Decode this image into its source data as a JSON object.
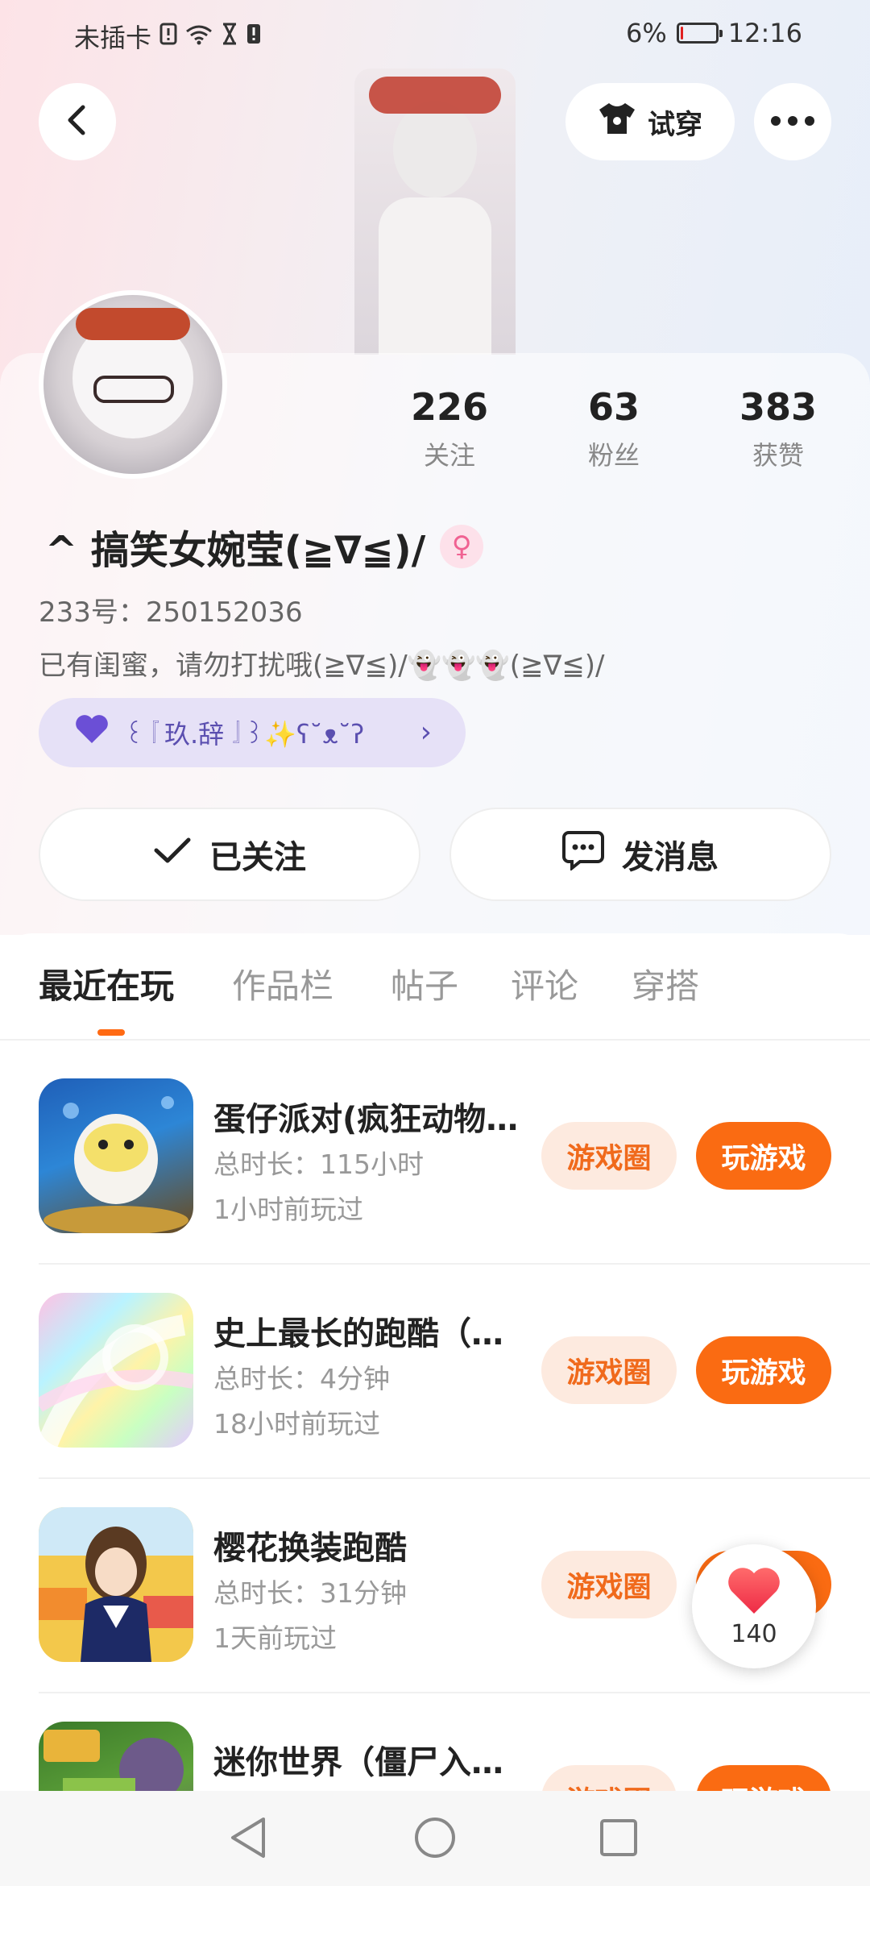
{
  "status_bar": {
    "carrier": "未插卡",
    "battery_percent": "6%",
    "battery_level": 0.06,
    "time": "12:16"
  },
  "header": {
    "back_icon": "chevron-left-icon",
    "try_on_label": "试穿",
    "try_on_icon": "tshirt-icon",
    "more_icon": "more-dots-icon"
  },
  "profile": {
    "stats": [
      {
        "value": "226",
        "label": "关注"
      },
      {
        "value": "63",
        "label": "粉丝"
      },
      {
        "value": "383",
        "label": "获赞"
      }
    ],
    "name": "^ 搞笑女婉莹(≧∇≦)/",
    "gender_symbol": "♀",
    "uid": "233号：250152036",
    "bio": "已有闺蜜，请勿打扰哦(≧∇≦)/👻👻👻(≧∇≦)/",
    "guild_name": "꒰『玖.辞』꒱✨ʕ˘ᴥ˘ʔ",
    "guild_icon": "purple-heart-icon"
  },
  "actions": {
    "follow_label": "已关注",
    "message_label": "发消息"
  },
  "tabs": [
    "最近在玩",
    "作品栏",
    "帖子",
    "评论",
    "穿搭"
  ],
  "games": [
    {
      "title": "蛋仔派对(疯狂动物…",
      "duration": "总时长：115小时",
      "last_played": "1小时前玩过",
      "circle_label": "游戏圈",
      "play_label": "玩游戏"
    },
    {
      "title": "史上最长的跑酷（…",
      "duration": "总时长：4分钟",
      "last_played": "18小时前玩过",
      "circle_label": "游戏圈",
      "play_label": "玩游戏"
    },
    {
      "title": "樱花换装跑酷",
      "duration": "总时长：31分钟",
      "last_played": "1天前玩过",
      "circle_label": "游戏圈",
      "play_label": "玩游戏"
    },
    {
      "title": "迷你世界（僵尸入…",
      "duration": "",
      "last_played": "",
      "circle_label": "游戏圈",
      "play_label": "玩游戏"
    }
  ],
  "like_fab": {
    "count": "140",
    "icon": "heart-icon"
  },
  "colors": {
    "accent": "#fa6b12",
    "circle_bg": "#fdeadf",
    "guild_bg": "#e6e1f7"
  }
}
